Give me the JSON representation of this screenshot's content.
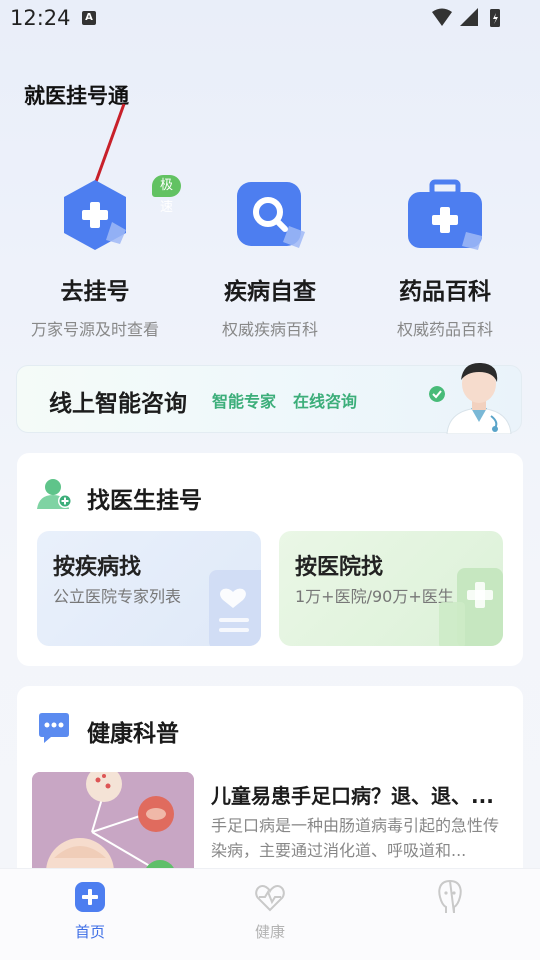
{
  "status_bar": {
    "time": "12:24",
    "notification_icon": "A"
  },
  "annotation": {
    "label": "就医挂号通"
  },
  "features": [
    {
      "title": "去挂号",
      "subtitle": "万家号源及时查看",
      "badge": "极速",
      "icon": "hexagon-plus-icon"
    },
    {
      "title": "疾病自查",
      "subtitle": "权威疾病百科",
      "icon": "search-icon"
    },
    {
      "title": "药品百科",
      "subtitle": "权威药品百科",
      "icon": "medicine-kit-icon"
    }
  ],
  "consult": {
    "title": "线上智能咨询",
    "tag1": "智能专家",
    "tag2": "在线咨询"
  },
  "find_doctor": {
    "title": "找医生挂号",
    "by_disease": {
      "title": "按疾病找",
      "desc": "公立医院专家列表"
    },
    "by_hospital": {
      "title": "按医院找",
      "desc": "1万+医院/90万+医生"
    }
  },
  "health": {
    "title": "健康科普",
    "article": {
      "title": "儿童易患手足口病？退、退、...",
      "desc": "手足口病是一种由肠道病毒引起的急性传染病，主要通过消化道、呼吸道和..."
    }
  },
  "bottom_nav": [
    {
      "label": "首页",
      "active": true
    },
    {
      "label": "健康",
      "active": false
    },
    {
      "label": "",
      "active": false
    }
  ],
  "colors": {
    "primary": "#3f6fe6",
    "green": "#3cae7a",
    "badge_green": "#62c262"
  }
}
